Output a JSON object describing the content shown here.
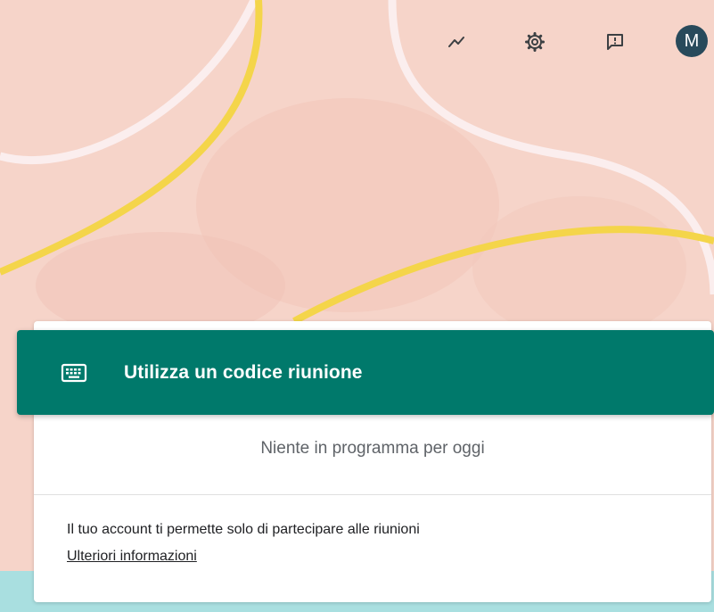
{
  "topbar": {
    "activity_icon": "trending-icon",
    "settings_icon": "gear-icon",
    "feedback_icon": "feedback-icon",
    "avatar_initial": "M"
  },
  "join": {
    "icon": "keyboard-icon",
    "label": "Utilizza un codice riunione"
  },
  "schedule": {
    "empty_message": "Niente in programma per oggi"
  },
  "account_notice": {
    "text": "Il tuo account ti permette solo di partecipare alle riunioni",
    "link": "Ulteriori informazioni"
  },
  "colors": {
    "background": "#f6d3c8",
    "accent": "#00796b",
    "avatar": "#284a5b"
  }
}
